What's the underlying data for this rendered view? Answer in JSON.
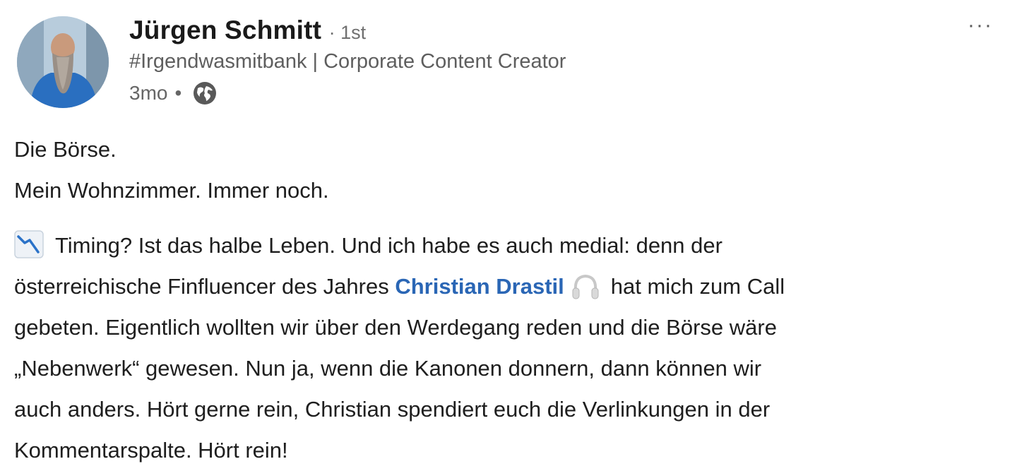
{
  "author": {
    "name": "Jürgen Schmitt",
    "degree": "· 1st",
    "headline": "#Irgendwasmitbank | Corporate Content Creator",
    "time": "3mo",
    "separator": "•",
    "visibility_icon": "globe-icon",
    "avatar_icon": "avatar"
  },
  "menu": {
    "more_label": "···"
  },
  "post": {
    "line1": "Die Börse.",
    "line2": "Mein Wohnzimmer. Immer noch.",
    "p2_line1": "Timing? Ist das halbe Leben. Und ich habe es auch medial: denn der",
    "p2_line2_before": "österreichische Finfluencer des Jahres",
    "mention": "Christian Drastil",
    "p2_line2_after": "hat mich zum Call",
    "p2_line3": "gebeten. Eigentlich wollten wir über den Werdegang reden und die Börse wäre",
    "p2_line4": "„Nebenwerk“ gewesen. Nun ja, wenn die Kanonen donnern, dann können wir",
    "p2_line5": "auch anders. Hört gerne rein, Christian spendiert euch die Verlinkungen in der",
    "p2_line6": "Kommentarspalte. Hört rein!",
    "emoji_chart": "chart-decreasing-icon",
    "emoji_headphones": "headphones-icon"
  },
  "colors": {
    "mention": "#2a66b5",
    "secondary_text": "#666666"
  }
}
